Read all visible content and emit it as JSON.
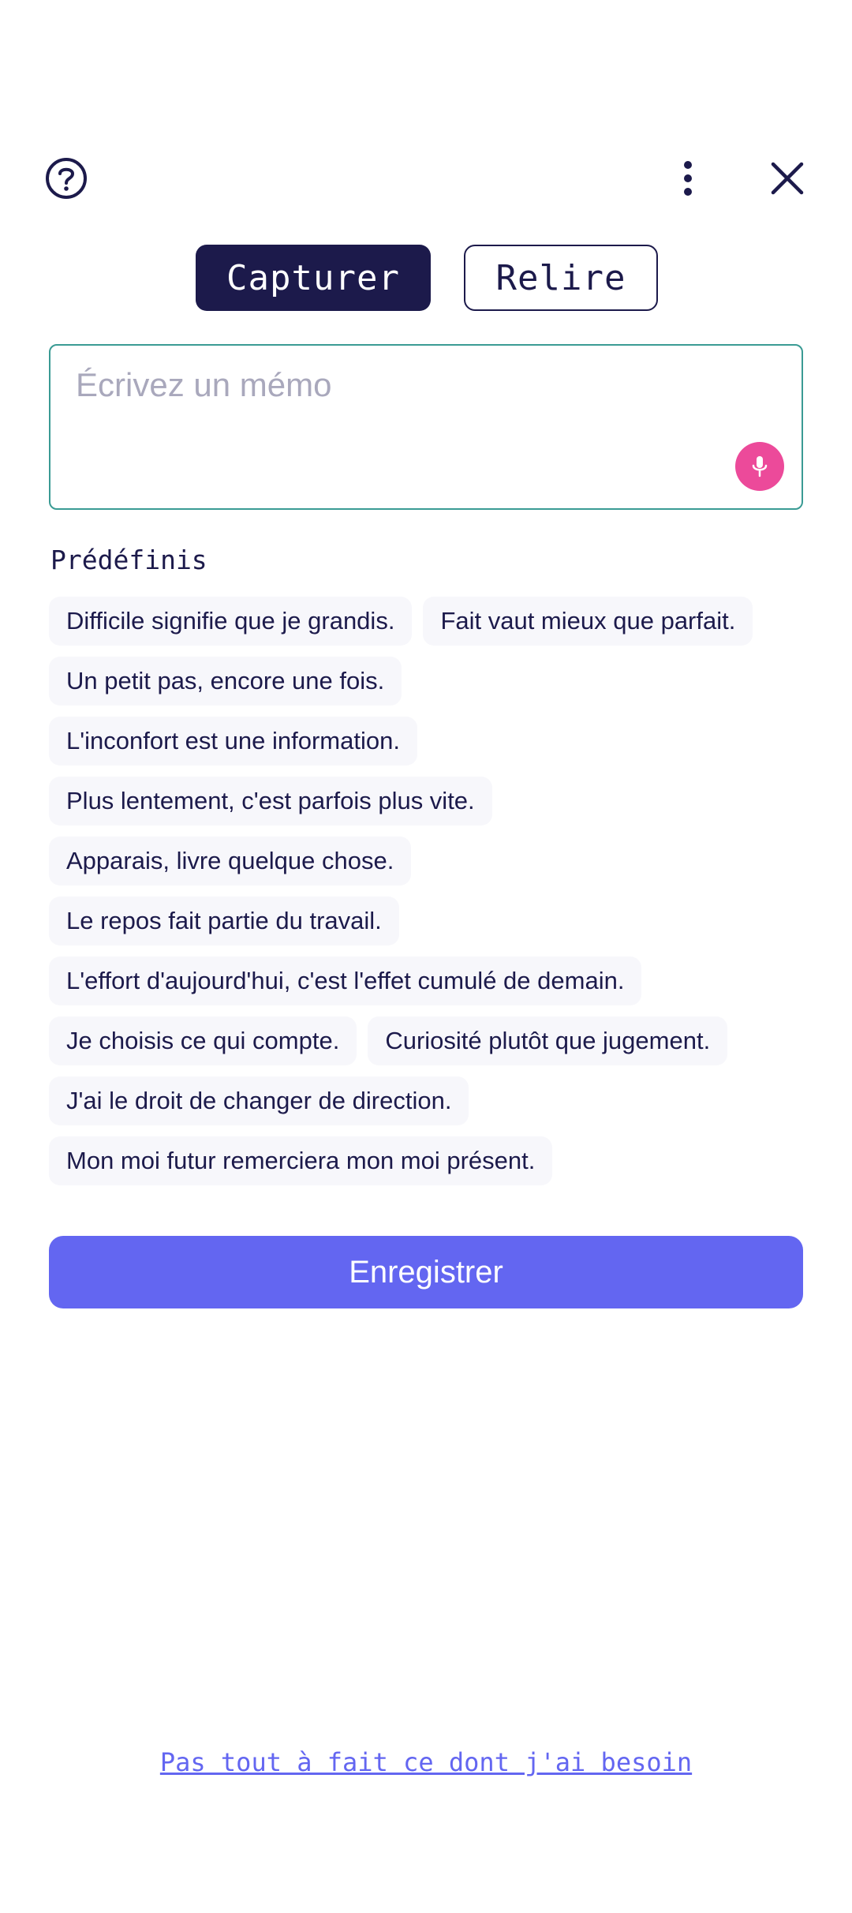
{
  "header": {
    "help_icon": "help-circle-icon",
    "more_icon": "more-vertical-icon",
    "close_icon": "close-icon"
  },
  "tabs": {
    "capture": "Capturer",
    "review": "Relire",
    "active": "capture"
  },
  "memo": {
    "placeholder": "Écrivez un mémo",
    "value": "",
    "mic_icon": "microphone-icon"
  },
  "presets": {
    "title": "Prédéfinis",
    "rows": [
      [
        "Difficile signifie que je grandis.",
        "Fait vaut mieux que parfait."
      ],
      [
        "Un petit pas, encore une fois."
      ],
      [
        "L'inconfort est une information."
      ],
      [
        "Plus lentement, c'est parfois plus vite."
      ],
      [
        "Apparais, livre quelque chose."
      ],
      [
        "Le repos fait partie du travail."
      ],
      [
        "L'effort d'aujourd'hui, c'est l'effet cumulé de demain."
      ],
      [
        "Je choisis ce qui compte.",
        "Curiosité plutôt que jugement."
      ],
      [
        "J'ai le droit de changer de direction."
      ],
      [
        "Mon moi futur remerciera mon moi présent."
      ]
    ]
  },
  "actions": {
    "save_label": "Enregistrer",
    "bottom_link": "Pas tout à fait ce dont j'ai besoin"
  },
  "colors": {
    "primary_dark": "#1c1a4b",
    "accent": "#6366f1",
    "mic": "#ec4a9a",
    "memo_border": "#3a9b94",
    "chip_bg": "#f7f7fb"
  }
}
